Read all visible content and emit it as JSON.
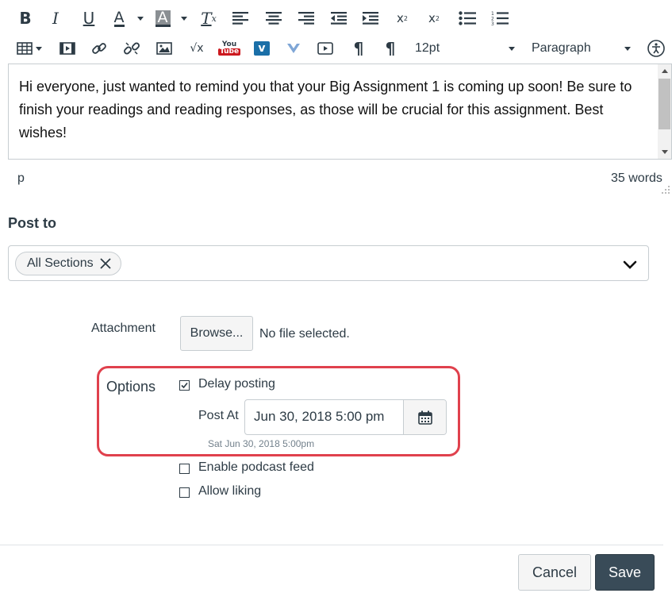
{
  "toolbar": {
    "font_size": "12pt",
    "block_format": "Paragraph",
    "youtube_label": "You Tube",
    "vimeo_label": "v",
    "icons_row1": [
      "bold-icon",
      "italic-icon",
      "underline-icon",
      "text-color-icon",
      "background-color-icon",
      "clear-formatting-icon",
      "align-left-icon",
      "align-center-icon",
      "align-right-icon",
      "outdent-icon",
      "indent-icon",
      "superscript-icon",
      "subscript-icon",
      "bullet-list-icon",
      "numbered-list-icon"
    ],
    "icons_row2": [
      "table-icon",
      "media-icon",
      "link-icon",
      "unlink-icon",
      "image-icon",
      "equation-icon",
      "youtube-icon",
      "vimeo-icon",
      "v-icon",
      "embed-media-icon",
      "ltr-icon",
      "rtl-icon",
      "accessibility-icon"
    ]
  },
  "editor": {
    "body_text": "Hi everyone, just wanted to remind you that your Big Assignment 1 is coming up soon! Be sure to finish your readings and reading responses, as those will be crucial for this assignment. Best wishes!",
    "path": "p",
    "word_count": "35 words"
  },
  "post_to": {
    "label": "Post to",
    "selected_section": "All Sections"
  },
  "attachment": {
    "label": "Attachment",
    "browse_label": "Browse...",
    "file_status": "No file selected."
  },
  "options": {
    "label": "Options",
    "delay_posting_label": "Delay posting",
    "delay_posting_checked": true,
    "post_at_label": "Post At",
    "post_at_value": "Jun 30, 2018 5:00 pm",
    "post_at_hint": "Sat Jun 30, 2018 5:00pm",
    "podcast_label": "Enable podcast feed",
    "podcast_checked": false,
    "liking_label": "Allow liking",
    "liking_checked": false
  },
  "footer": {
    "cancel_label": "Cancel",
    "save_label": "Save"
  },
  "colors": {
    "highlight_border": "#e0414d",
    "save_button_bg": "#394b58",
    "text": "#2d3b45"
  }
}
